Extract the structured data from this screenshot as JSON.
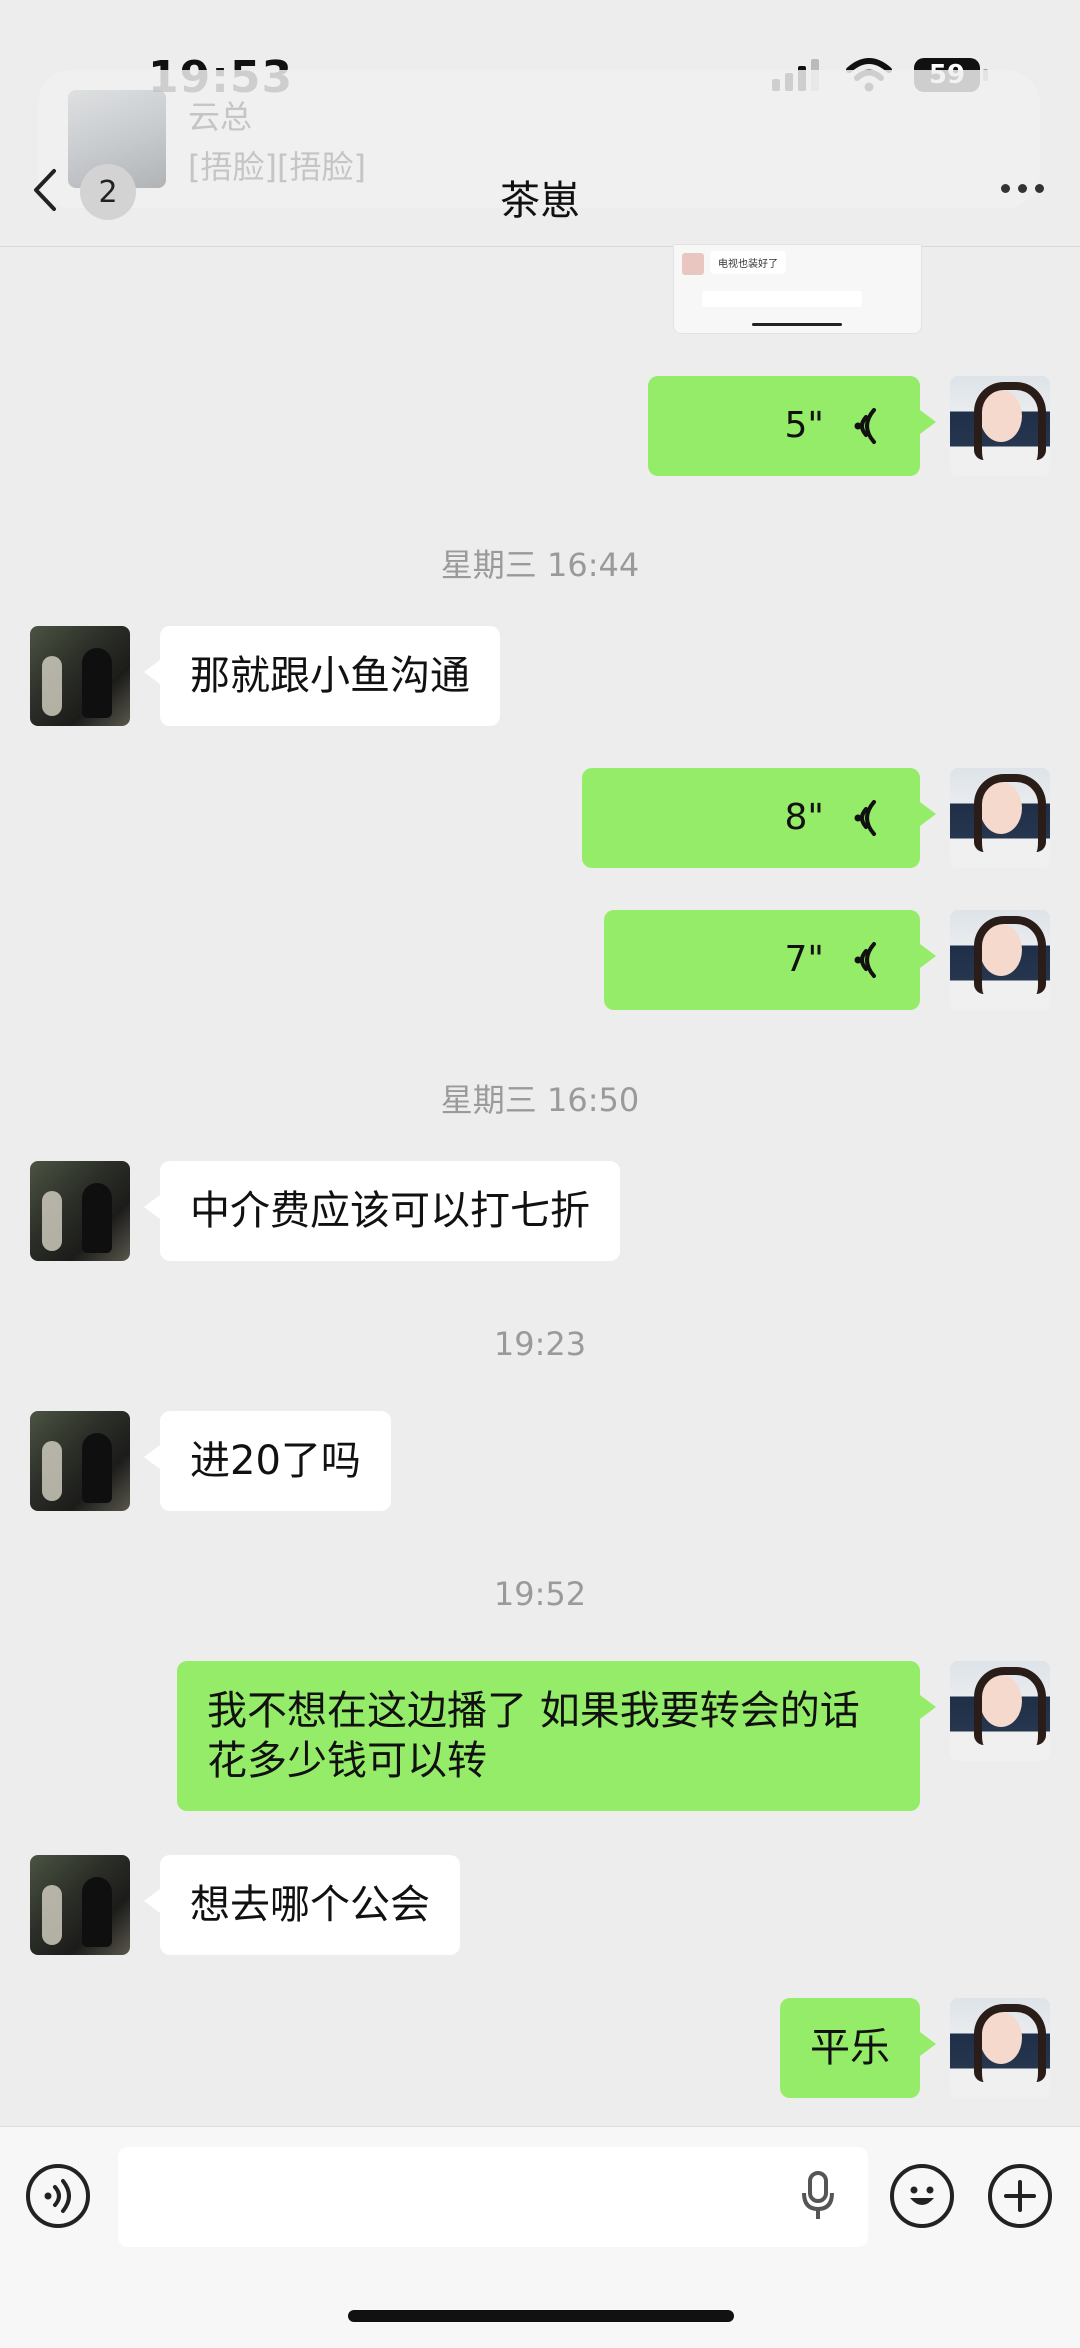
{
  "status": {
    "time": "19:53",
    "battery": "59"
  },
  "banner": {
    "name": "云总",
    "message": "[捂脸][捂脸]"
  },
  "nav": {
    "unread": "2",
    "title": "茶崽"
  },
  "image_thumb": {
    "text": "电视也装好了"
  },
  "messages": {
    "voice1": {
      "duration": "5\""
    },
    "ts1": "星期三 16:44",
    "m1": "那就跟小鱼沟通",
    "voice2": {
      "duration": "8\""
    },
    "voice3": {
      "duration": "7\""
    },
    "ts2": "星期三 16:50",
    "m2": "中介费应该可以打七折",
    "ts3": "19:23",
    "m3": "进20了吗",
    "ts4": "19:52",
    "m4_line1": "我不想在这边播了 如果我要转会的话",
    "m4_line2": "花多少钱可以转",
    "m5": "想去哪个公会",
    "m6": "平乐"
  },
  "input": {
    "placeholder": ""
  },
  "colors": {
    "me_bubble": "#95ec69",
    "other_bubble": "#ffffff",
    "background": "#ededed"
  }
}
